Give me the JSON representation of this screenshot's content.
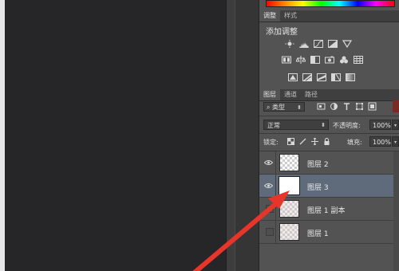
{
  "adjustments_panel": {
    "tabs": [
      {
        "label": "调整",
        "active": true
      },
      {
        "label": "样式",
        "active": false
      }
    ],
    "title": "添加调整",
    "icons_row1": [
      "brightness-icon",
      "levels-icon",
      "curves-icon",
      "exposure-icon",
      "vibrance-triangle-icon"
    ],
    "icons_row2": [
      "hue-saturation-icon",
      "color-balance-icon",
      "black-white-icon",
      "photo-filter-icon",
      "channel-mixer-icon",
      "color-lookup-icon"
    ],
    "icons_row3": [
      "invert-icon",
      "posterize-icon",
      "threshold-icon",
      "selective-color-icon",
      "gradient-map-icon"
    ]
  },
  "layers_panel": {
    "tabs": [
      {
        "label": "图层",
        "active": true
      },
      {
        "label": "通道",
        "active": false
      },
      {
        "label": "路径",
        "active": false
      }
    ],
    "filter": {
      "kind_label": "类型",
      "icons": [
        "pixel-filter-icon",
        "adjustment-filter-icon",
        "type-filter-icon",
        "shape-filter-icon",
        "smart-object-filter-icon"
      ]
    },
    "blend_mode": "正常",
    "opacity_label": "不透明度:",
    "opacity_value": "100%",
    "lock_label": "锁定:",
    "lock_icons": [
      "lock-transparent-icon",
      "lock-brush-icon",
      "lock-move-icon",
      "lock-all-icon"
    ],
    "fill_label": "填充:",
    "fill_value": "100%",
    "layers": [
      {
        "name": "图层 2",
        "visible": true,
        "selected": false,
        "thumb": "transparent"
      },
      {
        "name": "图层 3",
        "visible": true,
        "selected": true,
        "thumb": "white"
      },
      {
        "name": "图层 1 副本",
        "visible": false,
        "selected": false,
        "thumb": "pattern"
      },
      {
        "name": "图层 1",
        "visible": false,
        "selected": false,
        "thumb": "pattern"
      }
    ]
  },
  "colors": {
    "panel_bg": "#535353",
    "selected_layer": "#5f6b7a",
    "annotation_arrow": "#e8352a"
  }
}
